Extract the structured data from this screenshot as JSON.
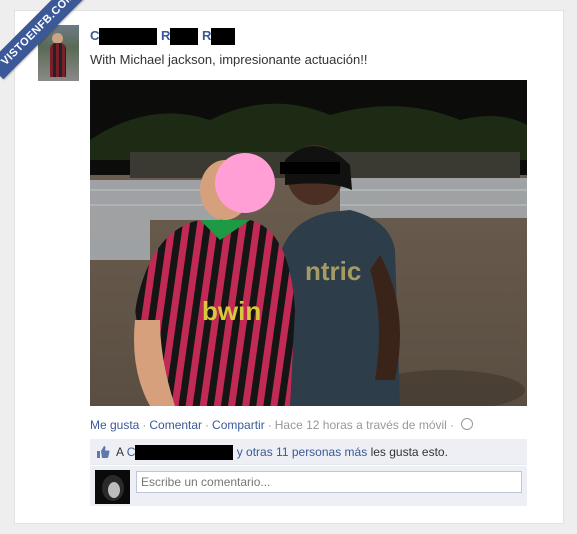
{
  "watermark": {
    "text": "VISTOENFB.COM"
  },
  "post": {
    "author_visible": [
      "C",
      "R",
      "R"
    ],
    "text": "With Michael jackson, impresionante actuación!!"
  },
  "actions": {
    "like": "Me gusta",
    "comment": "Comentar",
    "share": "Compartir",
    "time": "Hace 12 horas a través de móvil"
  },
  "likes": {
    "prefix": "A",
    "initial": "C",
    "others_link": "y otras 11 personas más",
    "suffix": "les gusta esto."
  },
  "comment": {
    "placeholder": "Escribe un comentario..."
  },
  "colors": {
    "brand_blue": "#3b5998",
    "pink_blur": "#ff9fd6"
  }
}
